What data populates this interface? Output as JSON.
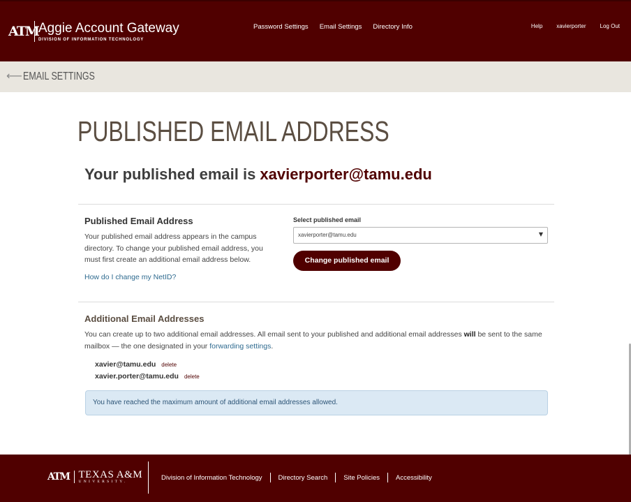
{
  "header": {
    "logo_mark": "ATM",
    "app_title": "Aggie Account Gateway",
    "app_subtitle": "DIVISION OF INFORMATION TECHNOLOGY",
    "nav": [
      "Password Settings",
      "Email Settings",
      "Directory Info"
    ],
    "help": "Help",
    "user": "xavierporter",
    "logout": "Log Out"
  },
  "breadcrumb": {
    "back_arrow": "⟵",
    "label": "EMAIL SETTINGS"
  },
  "page": {
    "title": "PUBLISHED EMAIL ADDRESS",
    "published_prefix": "Your published email is ",
    "published_email": "xavierporter@tamu.edu"
  },
  "published_section": {
    "heading": "Published Email Address",
    "description": "Your published email address appears in the campus directory. To change your published email address, you must first create an additional email address below.",
    "netid_link": "How do I change my NetID?",
    "select_label": "Select published email",
    "select_value": "xavierporter@tamu.edu",
    "button_label": "Change published email"
  },
  "additional_section": {
    "heading": "Additional Email Addresses",
    "text_before_bold": "You can create up to two additional email addresses. All email sent to your published and additional email addresses ",
    "bold_word": "will",
    "text_after_bold": " be sent to the same mailbox — the one designated in your ",
    "forwarding_link": "forwarding settings",
    "text_end": ".",
    "aliases": [
      {
        "email": "xavier@tamu.edu",
        "action": "delete"
      },
      {
        "email": "xavier.porter@tamu.edu",
        "action": "delete"
      }
    ],
    "alert": "You have reached the maximum amount of additional email addresses allowed."
  },
  "footer": {
    "logo_mark": "ATM",
    "logo_name": "TEXAS A&M",
    "logo_sub": "UNIVERSITY.",
    "links": [
      "Division of Information Technology",
      "Directory Search",
      "Site Policies",
      "Accessibility"
    ]
  },
  "colors": {
    "maroon": "#500000",
    "crumb_bg": "#e9e6df",
    "alert_bg": "#dbe9f4",
    "link": "#2e6a8f"
  }
}
